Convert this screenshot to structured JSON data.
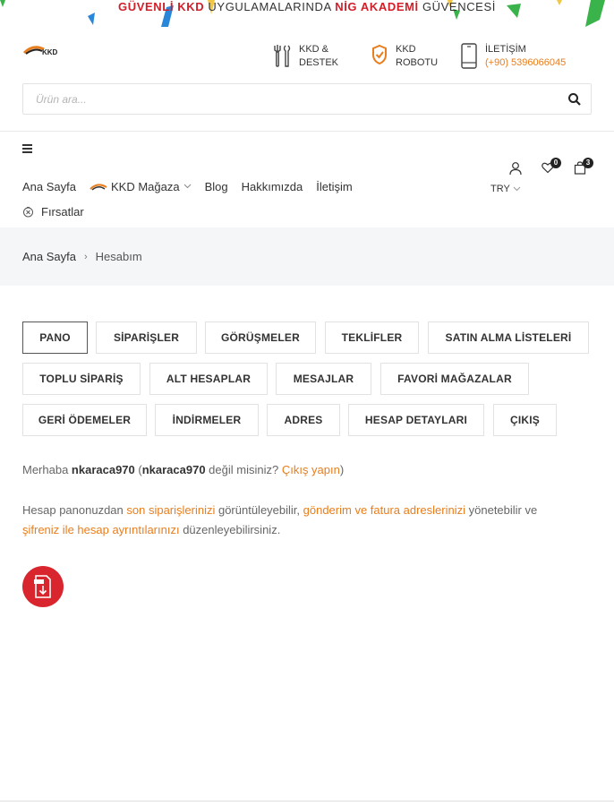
{
  "banner": {
    "part1": "GÜVENLİ KKD",
    "part2": " UYGULAMALARINDA ",
    "part3": "NİG AKADEMİ",
    "part4": " GÜVENCESİ"
  },
  "header": {
    "logo_text": "KKD",
    "support": {
      "line1": "KKD &",
      "line2": "DESTEK"
    },
    "robot": {
      "line1": "KKD",
      "line2": "ROBOTU"
    },
    "contact": {
      "line1": "İLETİŞİM",
      "phone": "(+90) 5396066045"
    }
  },
  "search": {
    "placeholder": "Ürün ara..."
  },
  "nav": {
    "items": [
      {
        "label": "Ana Sayfa"
      },
      {
        "label": "KKD Mağaza"
      },
      {
        "label": "Blog"
      },
      {
        "label": "Hakkımızda"
      },
      {
        "label": "İletişim"
      }
    ],
    "deals": "Fırsatlar"
  },
  "header_icons": {
    "wishlist_count": "0",
    "cart_count": "3",
    "currency": "TRY"
  },
  "breadcrumb": {
    "home": "Ana Sayfa",
    "current": "Hesabım"
  },
  "tabs": [
    {
      "label": "PANO"
    },
    {
      "label": "SİPARİŞLER"
    },
    {
      "label": "GÖRÜŞMELER"
    },
    {
      "label": "TEKLİFLER"
    },
    {
      "label": "SATIN ALMA LİSTELERİ"
    },
    {
      "label": "TOPLU SİPARİŞ"
    },
    {
      "label": "ALT HESAPLAR"
    },
    {
      "label": "MESAJLAR"
    },
    {
      "label": "FAVORİ MAĞAZALAR"
    },
    {
      "label": "GERİ ÖDEMELER"
    },
    {
      "label": "İNDİRMELER"
    },
    {
      "label": "ADRES"
    },
    {
      "label": "HESAP DETAYLARI"
    },
    {
      "label": "ÇIKIŞ"
    }
  ],
  "greeting": {
    "hello": "Merhaba ",
    "username": "nkaraca970",
    "paren_open": " (",
    "username2": "nkaraca970",
    "not_you": " değil misiniz? ",
    "logout": "Çıkış yapın",
    "paren_close": ")"
  },
  "dashboard": {
    "t1": "Hesap panonuzdan ",
    "l1": "son siparişlerinizi",
    "t2": " görüntüleyebilir, ",
    "l2": "gönderim ve fatura adreslerinizi",
    "t3": " yönetebilir ve",
    "l3": "şifreniz ile hesap ayrıntılarınızı",
    "t4": " düzenleyebilirsiniz."
  },
  "colors": {
    "accent": "#e87e1e",
    "brand_red": "#d0202a",
    "pdf_red": "#d9262e"
  }
}
